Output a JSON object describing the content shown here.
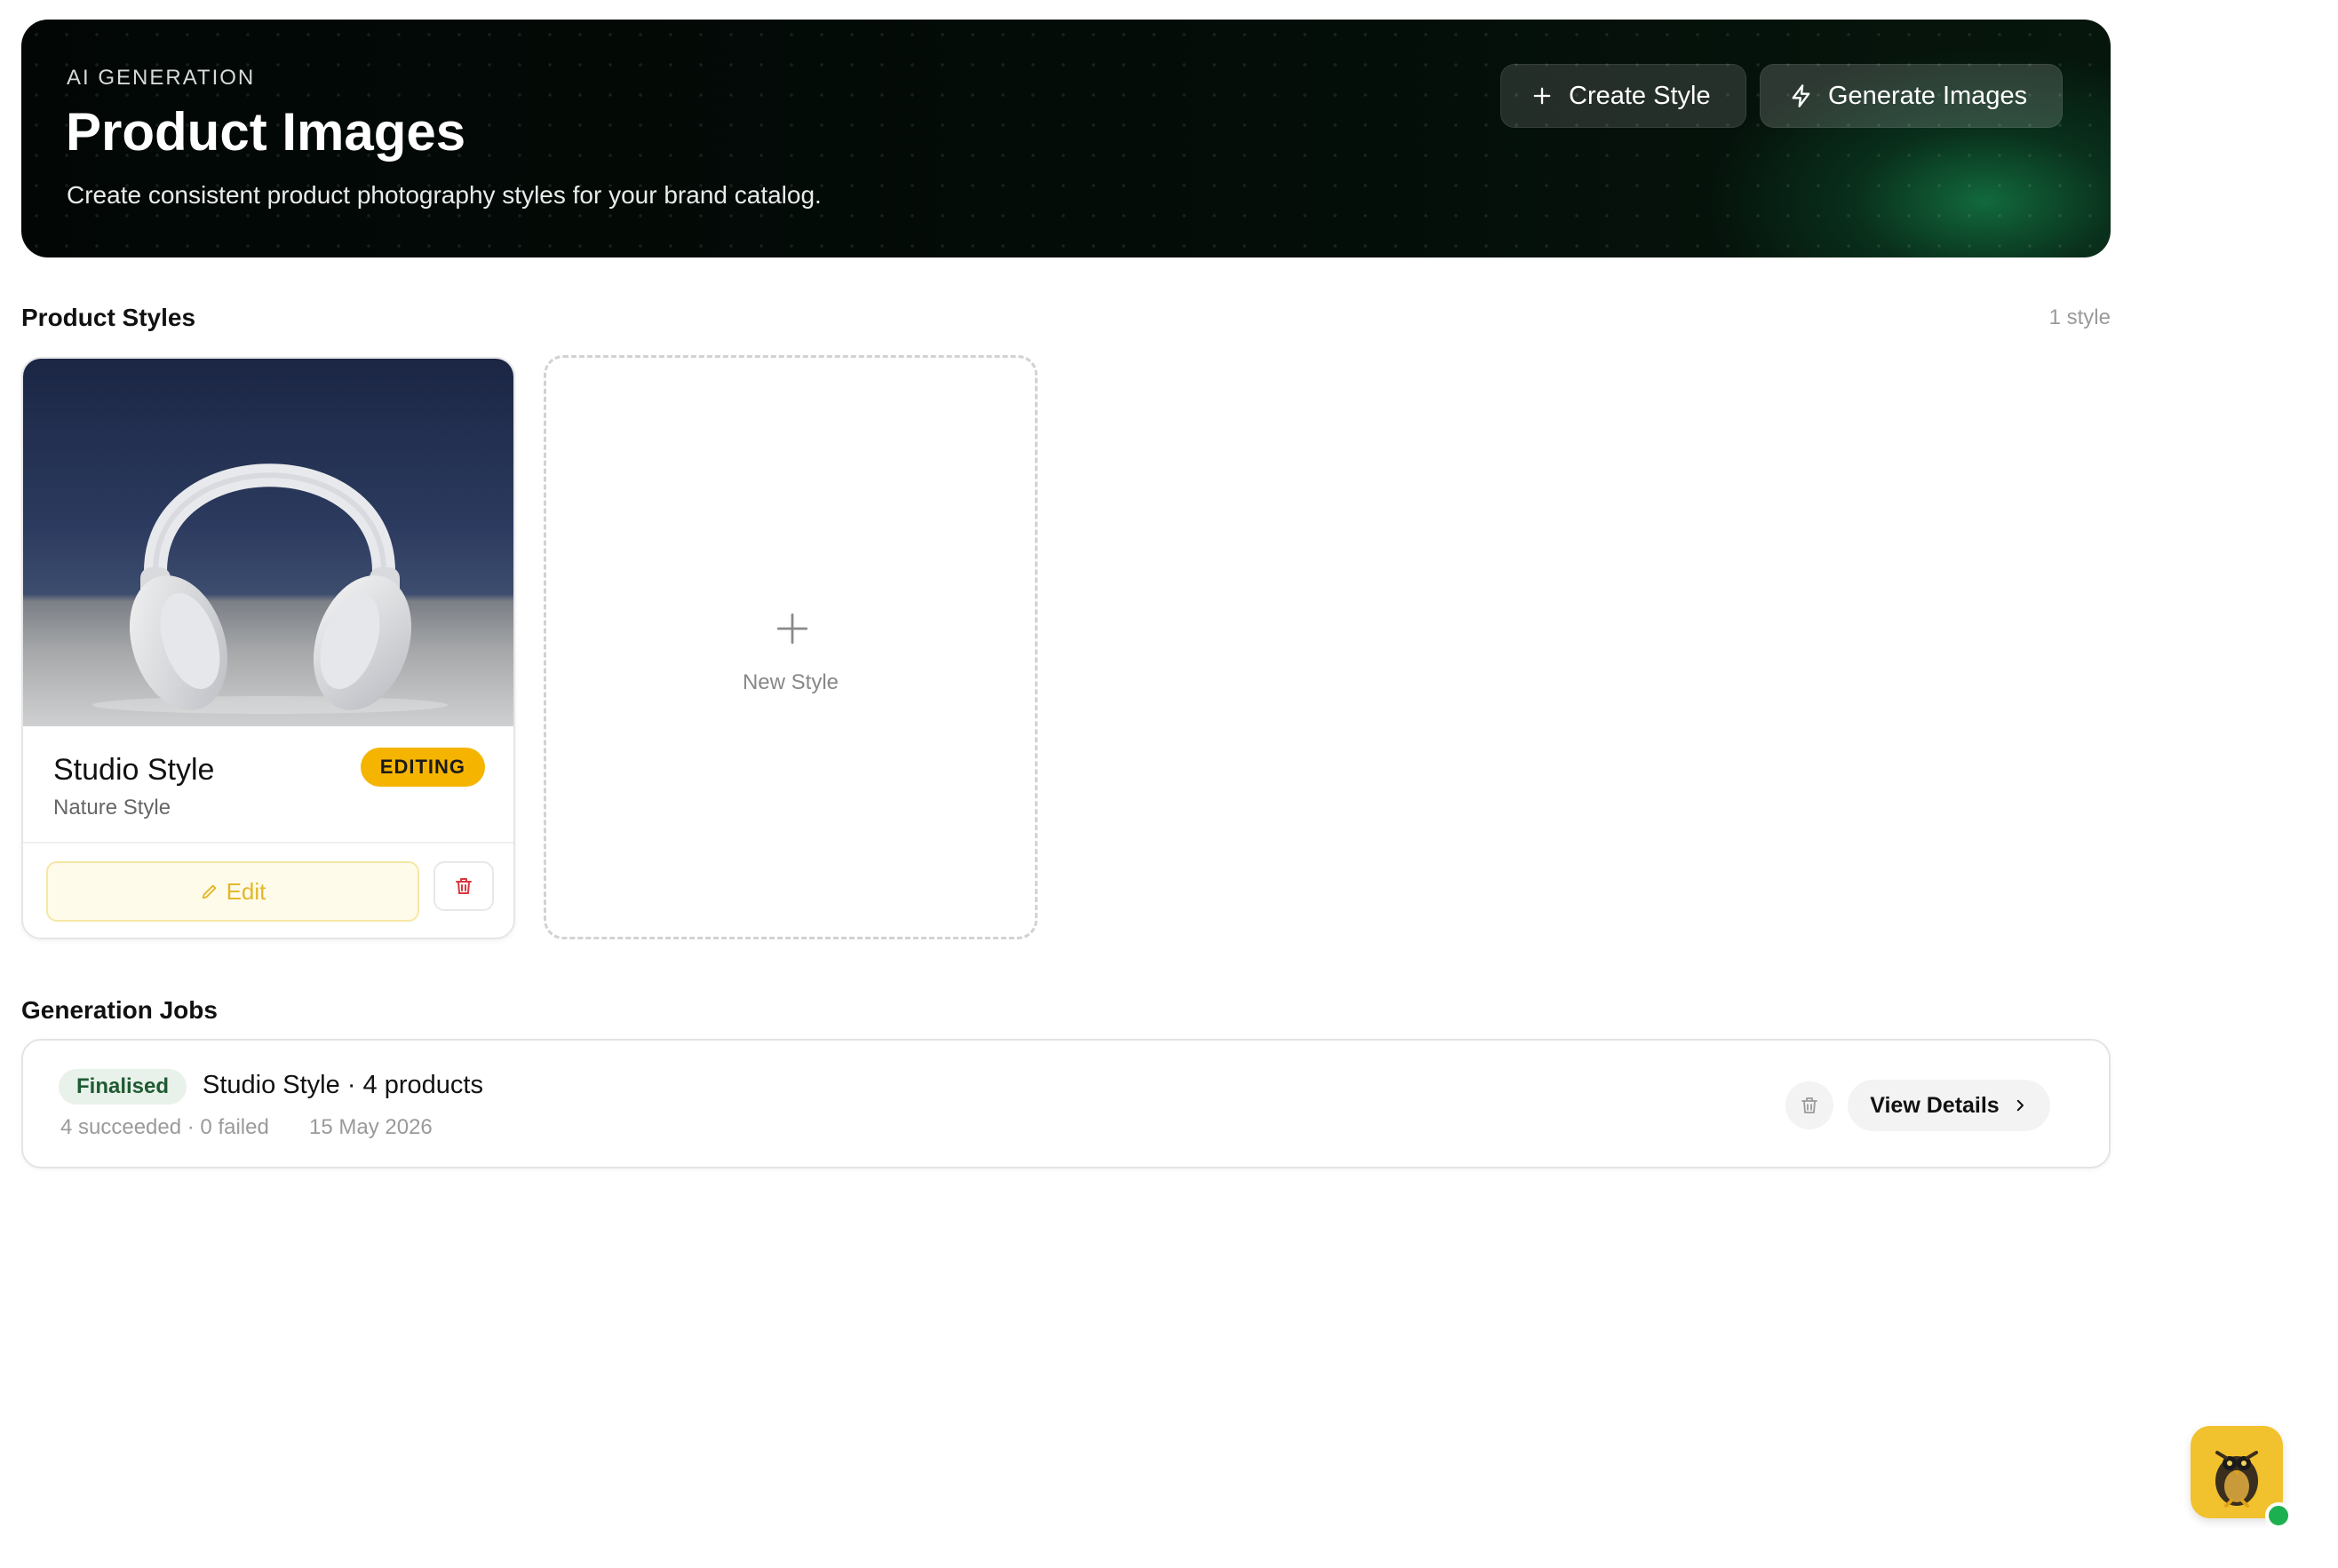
{
  "hero": {
    "eyebrow": "AI GENERATION",
    "title": "Product Images",
    "subtitle": "Create consistent product photography styles for your brand catalog.",
    "create_label": "Create Style",
    "generate_label": "Generate Images"
  },
  "styles_section": {
    "title": "Product Styles",
    "count": "1 style",
    "cards": [
      {
        "name": "Studio Style",
        "subtitle": "Nature Style",
        "badge": "EDITING",
        "edit_label": "Edit"
      }
    ],
    "new_style_label": "New Style"
  },
  "jobs_section": {
    "title": "Generation Jobs",
    "jobs": [
      {
        "status": "Finalised",
        "title": "Studio Style · 4 products",
        "meta": "4 succeeded · 0 failed",
        "date": "15 May 2026",
        "view_label": "View Details"
      }
    ]
  },
  "colors": {
    "accent_green": "#1db050",
    "editing_badge": "#f5b400",
    "finalised_badge_bg": "#e8f1ea",
    "delete_red": "#d9363e"
  },
  "icons": {
    "create": "plus-icon",
    "generate": "lightning-icon",
    "edit": "pencil-icon",
    "delete": "trash-icon",
    "view": "chevron-right-icon",
    "new_style": "plus-icon"
  }
}
